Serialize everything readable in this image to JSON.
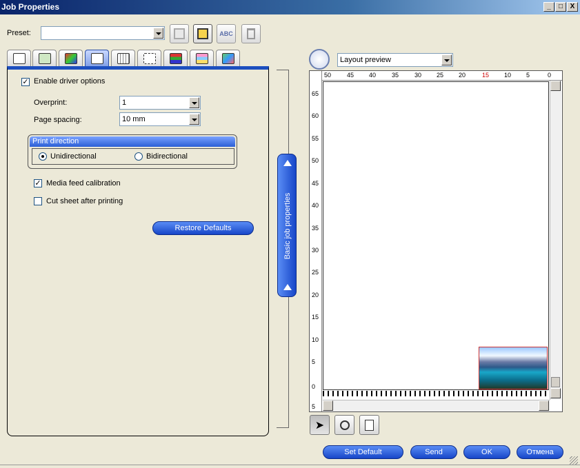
{
  "window": {
    "title": "Job Properties",
    "controls": [
      "_",
      "□",
      "X"
    ]
  },
  "preset": {
    "label": "Preset:",
    "value": ""
  },
  "toolbar": {
    "spellcheck_icon_text": "ABC"
  },
  "tabs": [
    {
      "icon": "document-icon"
    },
    {
      "icon": "copy-icon"
    },
    {
      "icon": "color-icon"
    },
    {
      "icon": "printer-icon",
      "active": true
    },
    {
      "icon": "layout-icon"
    },
    {
      "icon": "marks-icon"
    },
    {
      "icon": "color-bars-icon"
    },
    {
      "icon": "layers-icon"
    },
    {
      "icon": "eyedropper-icon"
    }
  ],
  "panel": {
    "enable_driver_options": {
      "label": "Enable driver options",
      "checked": true
    },
    "overprint": {
      "label": "Overprint:",
      "value": "1"
    },
    "page_spacing": {
      "label": "Page spacing:",
      "value": "10 mm"
    },
    "print_direction": {
      "title": "Print direction",
      "options": [
        "Unidirectional",
        "Bidirectional"
      ],
      "selected": "Unidirectional"
    },
    "media_feed_calibration": {
      "label": "Media feed calibration",
      "checked": true
    },
    "cut_sheet": {
      "label": "Cut sheet after printing",
      "checked": false
    },
    "restore_defaults": "Restore Defaults"
  },
  "side_tab": {
    "label": "Basic job properties"
  },
  "preview": {
    "mode": "Layout preview",
    "ruler_top": [
      "50",
      "45",
      "40",
      "35",
      "30",
      "25",
      "20",
      "15",
      "10",
      "5",
      "0"
    ],
    "ruler_left": [
      "65",
      "60",
      "55",
      "50",
      "45",
      "40",
      "35",
      "30",
      "25",
      "20",
      "15",
      "10",
      "5",
      "0",
      "5"
    ]
  },
  "buttons": {
    "set_default": "Set Default",
    "send": "Send",
    "ok": "OK",
    "cancel": "Отмена"
  }
}
